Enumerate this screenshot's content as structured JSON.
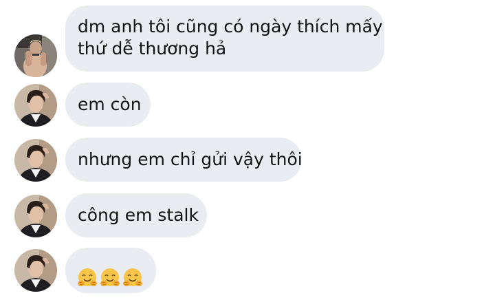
{
  "conversation": {
    "messages": [
      {
        "sender": "other-user",
        "avatar_icon": "avatar-photo-gym",
        "lines": [
          "dm anh tôi cũng có ngày thích mấy",
          "thứ dễ thương hả"
        ]
      },
      {
        "sender": "self",
        "avatar_icon": "avatar-photo-portrait",
        "lines": [
          "em còn"
        ]
      },
      {
        "sender": "self",
        "avatar_icon": "avatar-photo-portrait",
        "lines": [
          "nhưng em chỉ gửi vậy thôi"
        ]
      },
      {
        "sender": "self",
        "avatar_icon": "avatar-photo-portrait",
        "lines": [
          "công em stalk"
        ]
      },
      {
        "sender": "self",
        "avatar_icon": "avatar-photo-portrait",
        "emoji": [
          "hugging-face-emoji",
          "hugging-face-emoji",
          "hugging-face-emoji"
        ]
      }
    ]
  },
  "colors": {
    "bubble_background": "#e9edf1",
    "text": "#141414",
    "emoji_face": "#f7c54a"
  }
}
